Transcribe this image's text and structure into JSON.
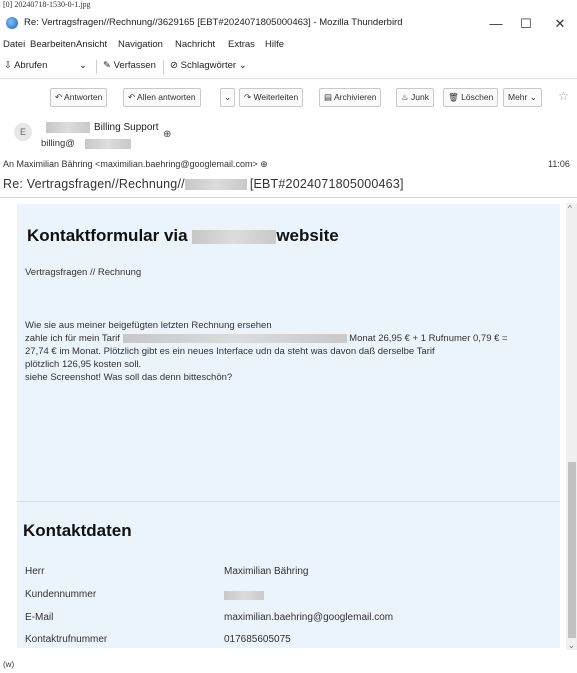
{
  "file_label": "[0] 20240718-1530-0-1.jpg",
  "window": {
    "title": "Re: Vertragsfragen//Rechnung//3629165 [EBT#2024071805000463] - Mozilla Thunderbird",
    "minimize": "—",
    "maximize": "☐",
    "close": "✕"
  },
  "menu": [
    "Datei",
    "Bearbeiten",
    "Ansicht",
    "Navigation",
    "Nachricht",
    "Extras",
    "Hilfe"
  ],
  "toolbar": {
    "fetch_label": "Abrufen",
    "compose_label": "Verfassen",
    "tags_label": "Schlagwörter"
  },
  "actions": {
    "reply": "Antworten",
    "reply_all": "Allen antworten",
    "forward": "Weiterleiten",
    "archive": "Archivieren",
    "junk": "Junk",
    "delete": "Löschen",
    "more": "Mehr"
  },
  "header": {
    "avatar_letter": "E",
    "from_name": "Billing Support",
    "from_email": "billing@",
    "to_label": "An",
    "to_value": "Maximilian Bähring <maximilian.baehring@googlemail.com>",
    "time": "11:06",
    "subject": "Re: Vertragsfragen//Rechnung//",
    "ticket": "[EBT#2024071805000463]"
  },
  "body": {
    "heading_prefix": "Kontaktformular via",
    "heading_suffix": "website",
    "category": "Vertragsfragen // Rechnung",
    "lines": [
      "Wie sie aus meiner beigefügten letzten Rechnung ersehen",
      "zahle ich für mein Tarif",
      "Monat 26,95 € + 1 Rufnumer 0,79 € =",
      "27,74 € im Monat. Plötzlich gibt es ein neues Interface udn da steht was davon daß derselbe Tarif",
      "plötzlich 126,95 kosten soll.",
      "siehe Screenshot! Was soll das denn bitteschön?"
    ],
    "contact_heading": "Kontaktdaten",
    "contact": [
      {
        "label": "Herr",
        "value": "Maximilian Bähring"
      },
      {
        "label": "Kundennummer",
        "value": ""
      },
      {
        "label": "E-Mail",
        "value": "maximilian.baehring@googlemail.com"
      },
      {
        "label": "Kontaktrufnummer",
        "value": "017685605075"
      }
    ]
  },
  "status_bar": "(w)"
}
